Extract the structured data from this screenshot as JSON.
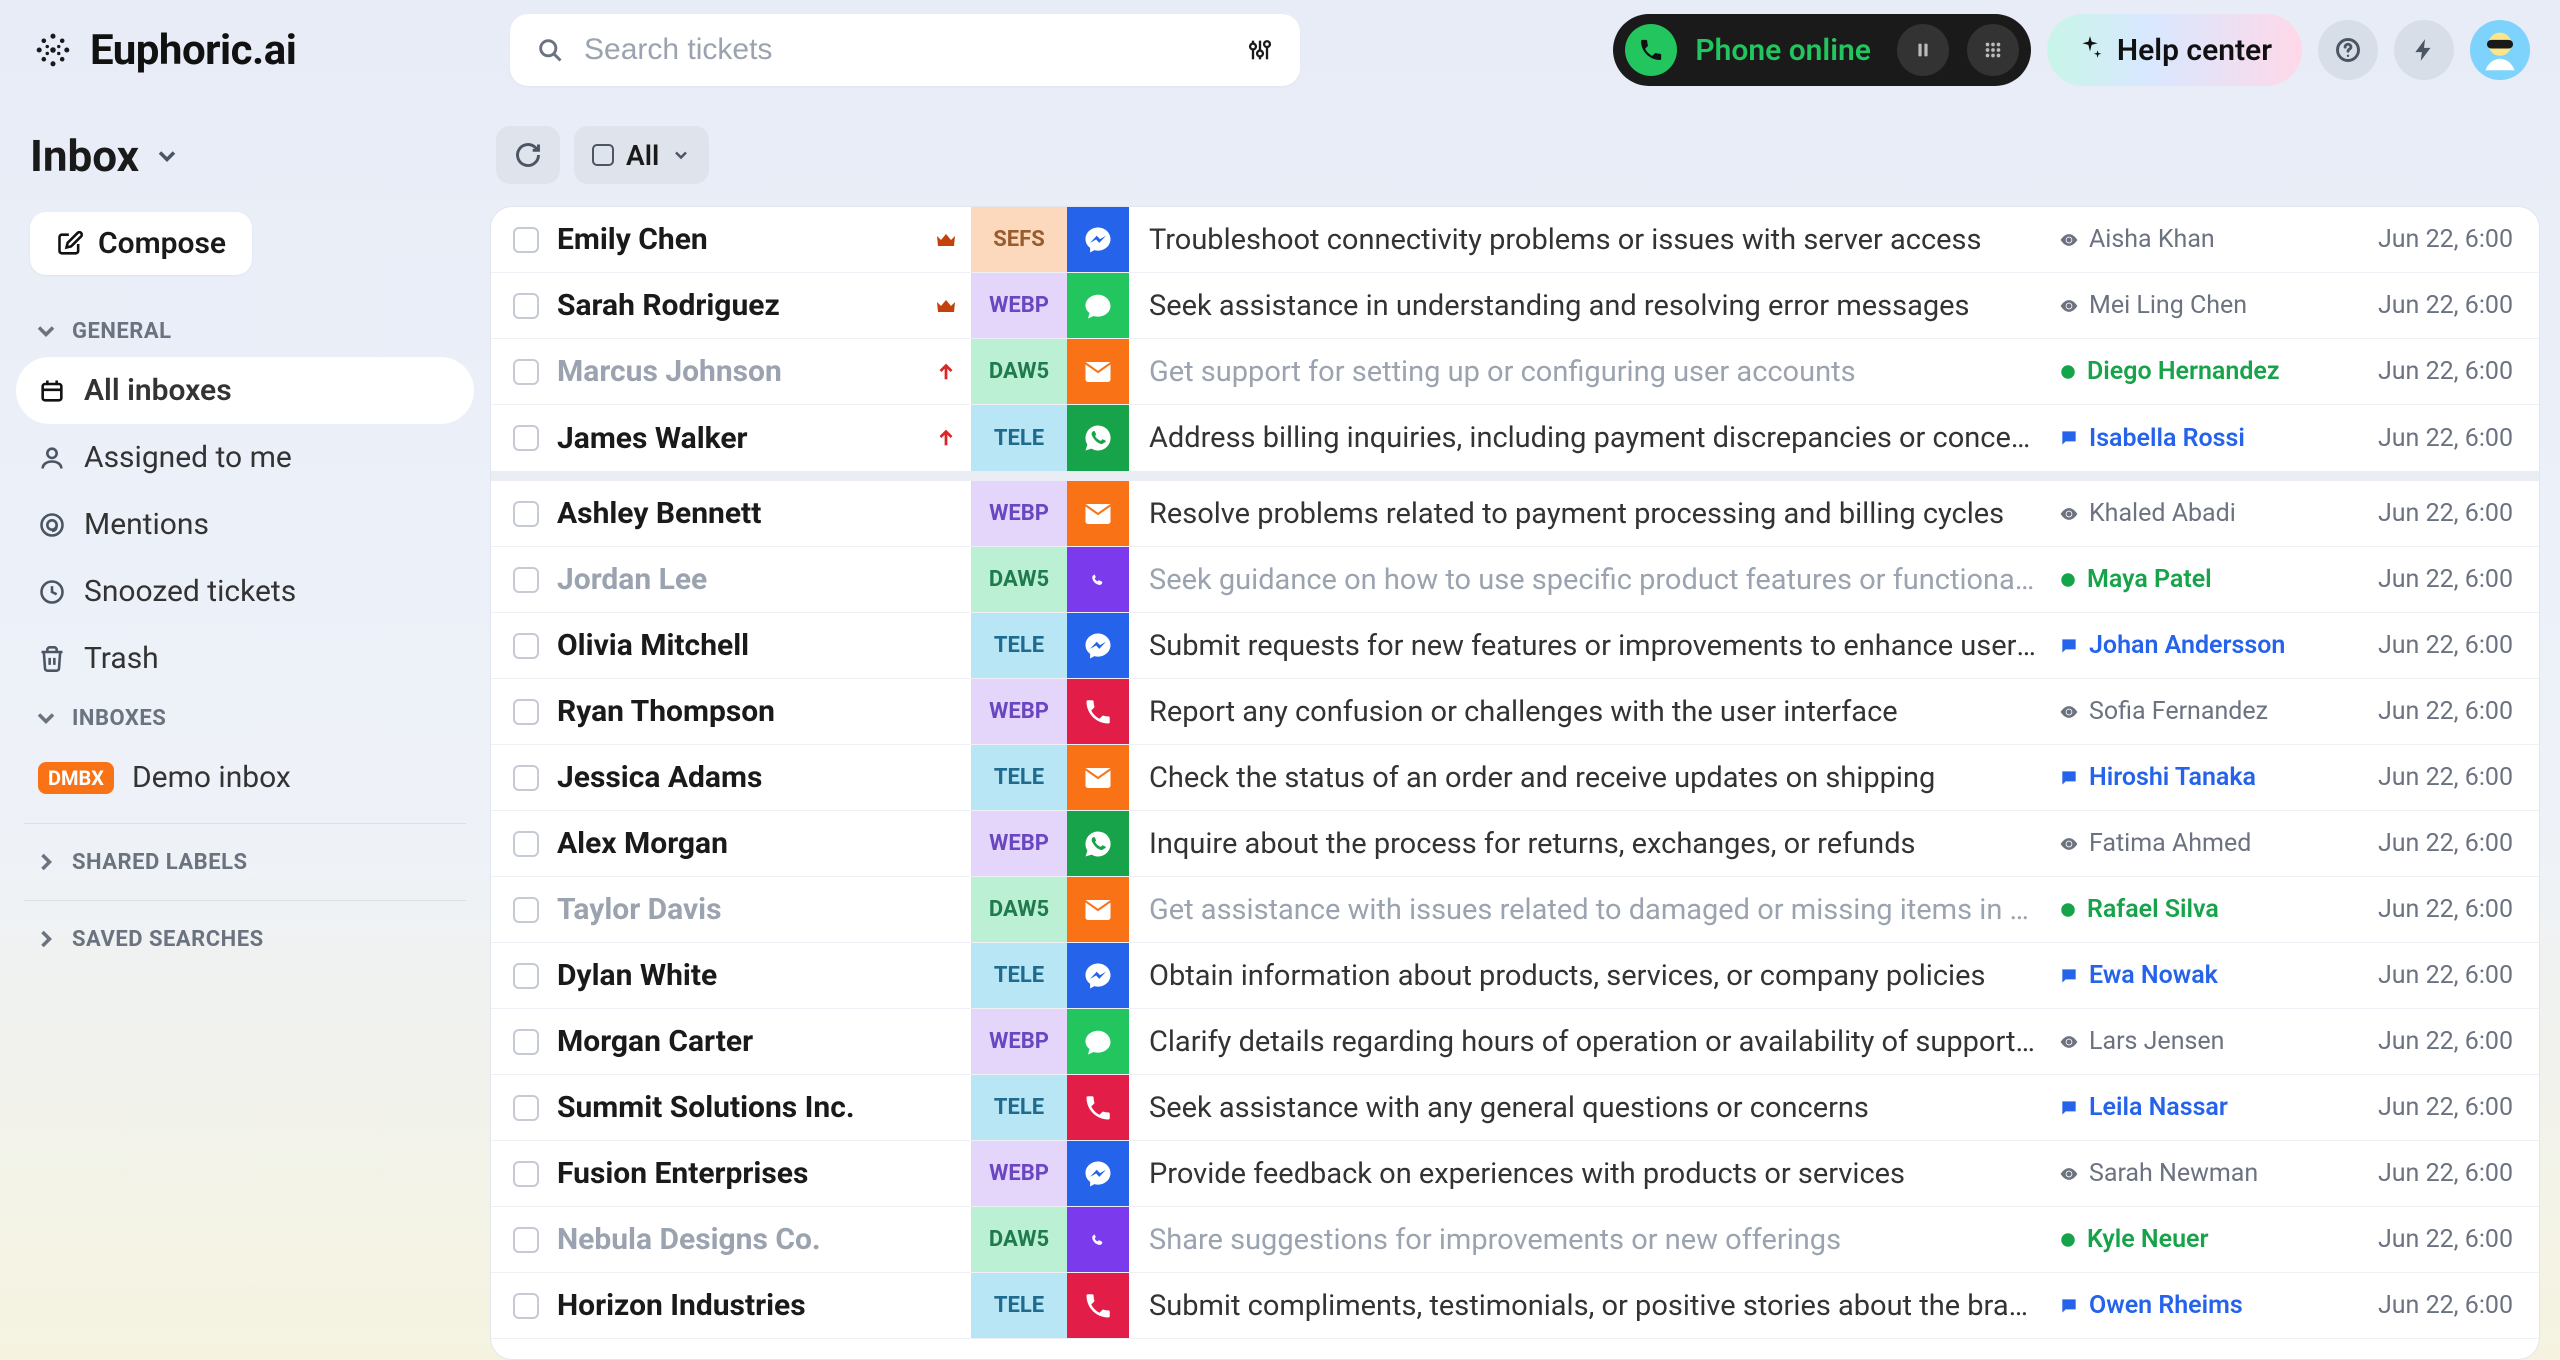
{
  "brand": "Euphoric.ai",
  "search": {
    "placeholder": "Search tickets"
  },
  "phone": {
    "status": "Phone online"
  },
  "help": {
    "label": "Help center"
  },
  "page_title": "Inbox",
  "compose": "Compose",
  "sidebar": {
    "general_label": "GENERAL",
    "items": [
      {
        "label": "All inboxes"
      },
      {
        "label": "Assigned to me"
      },
      {
        "label": "Mentions"
      },
      {
        "label": "Snoozed tickets"
      },
      {
        "label": "Trash"
      }
    ],
    "inboxes_label": "INBOXES",
    "inboxes": [
      {
        "badge": "DMBX",
        "label": "Demo inbox"
      }
    ],
    "shared_labels": "SHARED LABELS",
    "saved_searches": "SAVED SEARCHES"
  },
  "toolbar": {
    "filter": "All"
  },
  "tickets": [
    {
      "sender": "Emily Chen",
      "flag": "crown",
      "tag": "SEFS",
      "chan": "messenger",
      "subject": "Troubleshoot connectivity problems or issues with server access",
      "assignee": "Aisha Khan",
      "astatus": "grey",
      "time": "Jun 22, 6:00",
      "muted": false
    },
    {
      "sender": "Sarah Rodriguez",
      "flag": "crown",
      "tag": "WEBP",
      "chan": "imessage",
      "subject": "Seek assistance in understanding and resolving error messages",
      "assignee": "Mei Ling Chen",
      "astatus": "grey",
      "time": "Jun 22, 6:00",
      "muted": false
    },
    {
      "sender": "Marcus Johnson",
      "flag": "up",
      "tag": "DAW5",
      "chan": "email",
      "subject": "Get support for setting up or configuring user accounts",
      "assignee": "Diego Hernandez",
      "astatus": "green",
      "time": "Jun 22, 6:00",
      "muted": true
    },
    {
      "sender": "James Walker",
      "flag": "up",
      "tag": "TELE",
      "chan": "whatsapp",
      "subject": "Address billing inquiries, including payment discrepancies or conce…",
      "assignee": "Isabella Rossi",
      "astatus": "blue",
      "time": "Jun 22, 6:00",
      "muted": false,
      "pinned_end": true
    },
    {
      "sender": "Ashley Bennett",
      "flag": "",
      "tag": "WEBP",
      "chan": "email",
      "subject": "Resolve problems related to payment processing and billing cycles",
      "assignee": "Khaled Abadi",
      "astatus": "grey",
      "time": "Jun 22, 6:00",
      "muted": false
    },
    {
      "sender": "Jordan Lee",
      "flag": "",
      "tag": "DAW5",
      "chan": "viber",
      "subject": "Seek guidance on how to use specific product features or functiona…",
      "assignee": "Maya Patel",
      "astatus": "green",
      "time": "Jun 22, 6:00",
      "muted": true
    },
    {
      "sender": "Olivia Mitchell",
      "flag": "",
      "tag": "TELE",
      "chan": "messenger",
      "subject": "Submit requests for new features or improvements to enhance user e…",
      "assignee": "Johan Andersson",
      "astatus": "blue",
      "time": "Jun 22, 6:00",
      "muted": false
    },
    {
      "sender": "Ryan Thompson",
      "flag": "",
      "tag": "WEBP",
      "chan": "phone",
      "subject": "Report any confusion or challenges with the user interface",
      "assignee": "Sofia Fernandez",
      "astatus": "grey",
      "time": "Jun 22, 6:00",
      "muted": false
    },
    {
      "sender": "Jessica Adams",
      "flag": "",
      "tag": "TELE",
      "chan": "email",
      "subject": "Check the status of an order and receive updates on shipping",
      "assignee": "Hiroshi Tanaka",
      "astatus": "blue",
      "time": "Jun 22, 6:00",
      "muted": false
    },
    {
      "sender": "Alex Morgan",
      "flag": "",
      "tag": "WEBP",
      "chan": "whatsapp",
      "subject": "Inquire about the process for returns, exchanges, or refunds",
      "assignee": "Fatima Ahmed",
      "astatus": "grey",
      "time": "Jun 22, 6:00",
      "muted": false
    },
    {
      "sender": "Taylor Davis",
      "flag": "",
      "tag": "DAW5",
      "chan": "email",
      "subject": "Get assistance with issues related to damaged or missing items in s…",
      "assignee": "Rafael Silva",
      "astatus": "green",
      "time": "Jun 22, 6:00",
      "muted": true
    },
    {
      "sender": "Dylan White",
      "flag": "",
      "tag": "TELE",
      "chan": "messenger",
      "subject": "Obtain information about products, services, or company policies",
      "assignee": "Ewa Nowak",
      "astatus": "blue",
      "time": "Jun 22, 6:00",
      "muted": false
    },
    {
      "sender": "Morgan Carter",
      "flag": "",
      "tag": "WEBP",
      "chan": "imessage",
      "subject": "Clarify details regarding hours of operation or availability of support…",
      "assignee": "Lars Jensen",
      "astatus": "grey",
      "time": "Jun 22, 6:00",
      "muted": false
    },
    {
      "sender": "Summit Solutions Inc.",
      "flag": "",
      "tag": "TELE",
      "chan": "phone",
      "subject": "Seek assistance with any general questions or concerns",
      "assignee": "Leila Nassar",
      "astatus": "blue",
      "time": "Jun 22, 6:00",
      "muted": false
    },
    {
      "sender": "Fusion Enterprises",
      "flag": "",
      "tag": "WEBP",
      "chan": "messenger",
      "subject": "Provide feedback on experiences with products or services",
      "assignee": "Sarah Newman",
      "astatus": "grey",
      "time": "Jun 22, 6:00",
      "muted": false
    },
    {
      "sender": "Nebula Designs Co.",
      "flag": "",
      "tag": "DAW5",
      "chan": "viber",
      "subject": "Share suggestions for improvements or new offerings",
      "assignee": "Kyle Neuer",
      "astatus": "green",
      "time": "Jun 22, 6:00",
      "muted": true
    },
    {
      "sender": "Horizon Industries",
      "flag": "",
      "tag": "TELE",
      "chan": "phone",
      "subject": "Submit compliments, testimonials, or positive stories about the brand",
      "assignee": "Owen Rheims",
      "astatus": "blue",
      "time": "Jun 22, 6:00",
      "muted": false
    }
  ]
}
